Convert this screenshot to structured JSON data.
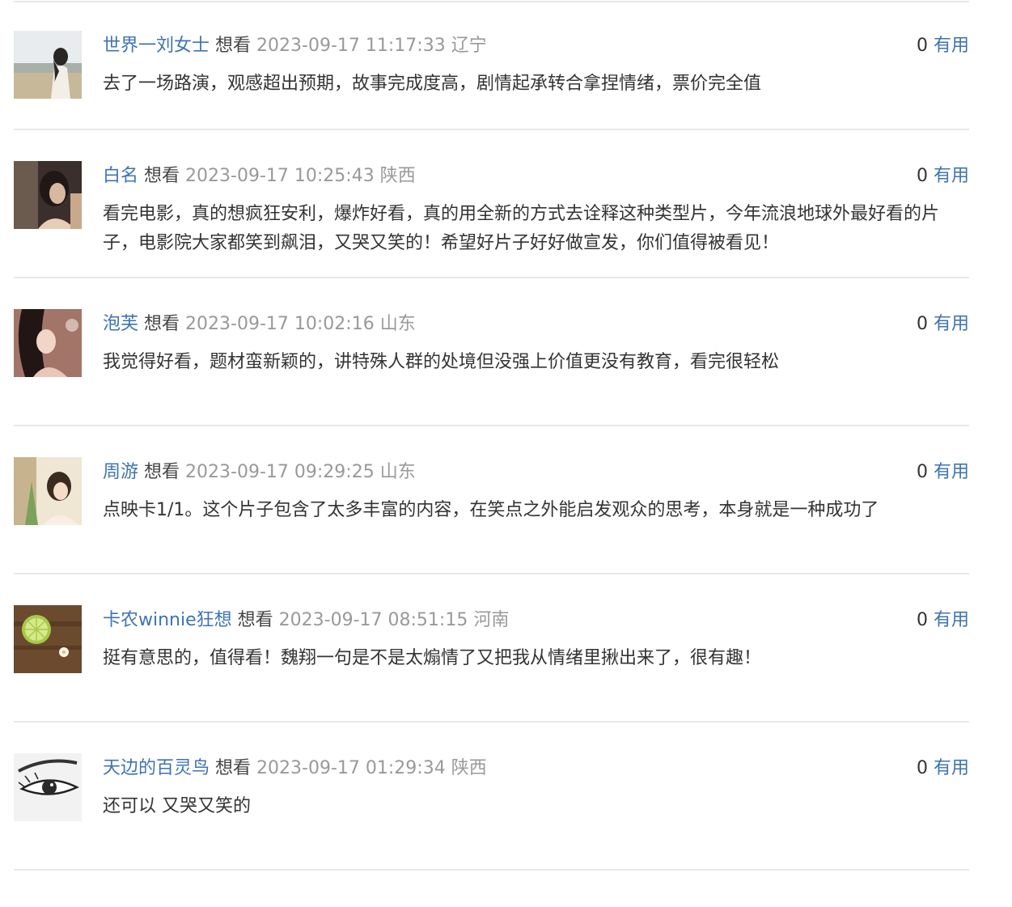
{
  "comments": [
    {
      "username": "世界一刘女士",
      "status": "想看",
      "time": "2023-09-17 11:17:33",
      "region": "辽宁",
      "useful_count": "0",
      "useful_label": "有用",
      "content": "去了一场路演，观感超出预期，故事完成度高，剧情起承转合拿捏情绪，票价完全值"
    },
    {
      "username": "白名",
      "status": "想看",
      "time": "2023-09-17 10:25:43",
      "region": "陕西",
      "useful_count": "0",
      "useful_label": "有用",
      "content": "看完电影，真的想疯狂安利，爆炸好看，真的用全新的方式去诠释这种类型片，今年流浪地球外最好看的片子，电影院大家都笑到飙泪，又哭又笑的！希望好片子好好做宣发，你们值得被看见！"
    },
    {
      "username": "泡芙",
      "status": "想看",
      "time": "2023-09-17 10:02:16",
      "region": "山东",
      "useful_count": "0",
      "useful_label": "有用",
      "content": "我觉得好看，题材蛮新颖的，讲特殊人群的处境但没强上价值更没有教育，看完很轻松"
    },
    {
      "username": "周游",
      "status": "想看",
      "time": "2023-09-17 09:29:25",
      "region": "山东",
      "useful_count": "0",
      "useful_label": "有用",
      "content": "点映卡1/1。这个片子包含了太多丰富的内容，在笑点之外能启发观众的思考，本身就是一种成功了"
    },
    {
      "username": "卡农winnie狂想",
      "status": "想看",
      "time": "2023-09-17 08:51:15",
      "region": "河南",
      "useful_count": "0",
      "useful_label": "有用",
      "content": "挺有意思的，值得看！魏翔一句是不是太煽情了又把我从情绪里揪出来了，很有趣！"
    },
    {
      "username": "天边的百灵鸟",
      "status": "想看",
      "time": "2023-09-17 01:29:34",
      "region": "陕西",
      "useful_count": "0",
      "useful_label": "有用",
      "content": "还可以 又哭又笑的"
    }
  ],
  "colors": {
    "link": "#3e73b3",
    "meta": "#999999",
    "text": "#333333",
    "divider": "#e8e8e8"
  }
}
